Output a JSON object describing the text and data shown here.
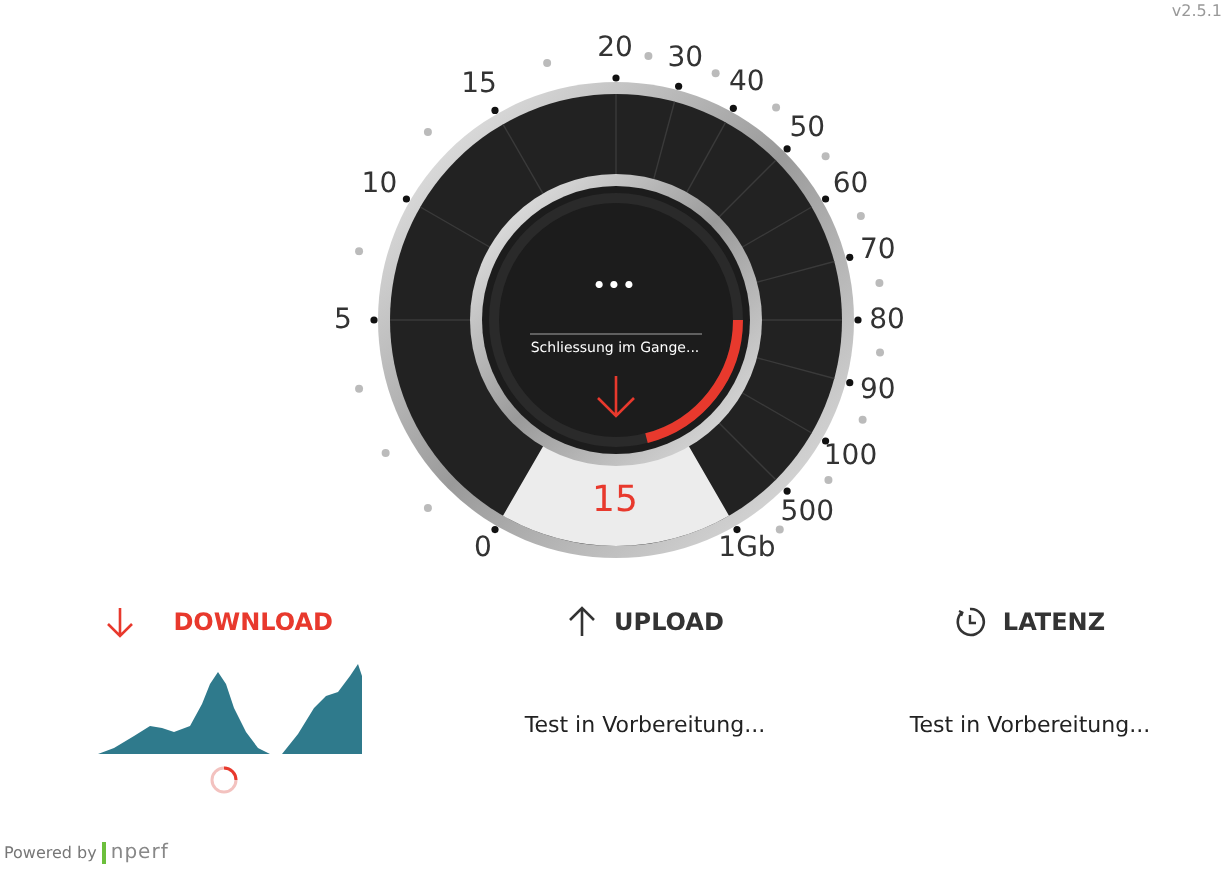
{
  "version": "v2.5.1",
  "gauge": {
    "scale": [
      "0",
      "5",
      "10",
      "15",
      "20",
      "30",
      "40",
      "50",
      "60",
      "70",
      "80",
      "90",
      "100",
      "500",
      "1Gb"
    ],
    "status": "•••",
    "message": "Schliessung im Gange...",
    "value": "15",
    "level": 0.21
  },
  "metrics": [
    {
      "kind": "download",
      "label": "DOWNLOAD",
      "active": true
    },
    {
      "kind": "upload",
      "label": "UPLOAD",
      "active": false,
      "status": "Test in Vorbereitung..."
    },
    {
      "kind": "latency",
      "label": "LATENZ",
      "active": false,
      "status": "Test in Vorbereitung..."
    }
  ],
  "footer": {
    "powered_by": "Powered by",
    "logo": "nperf"
  }
}
